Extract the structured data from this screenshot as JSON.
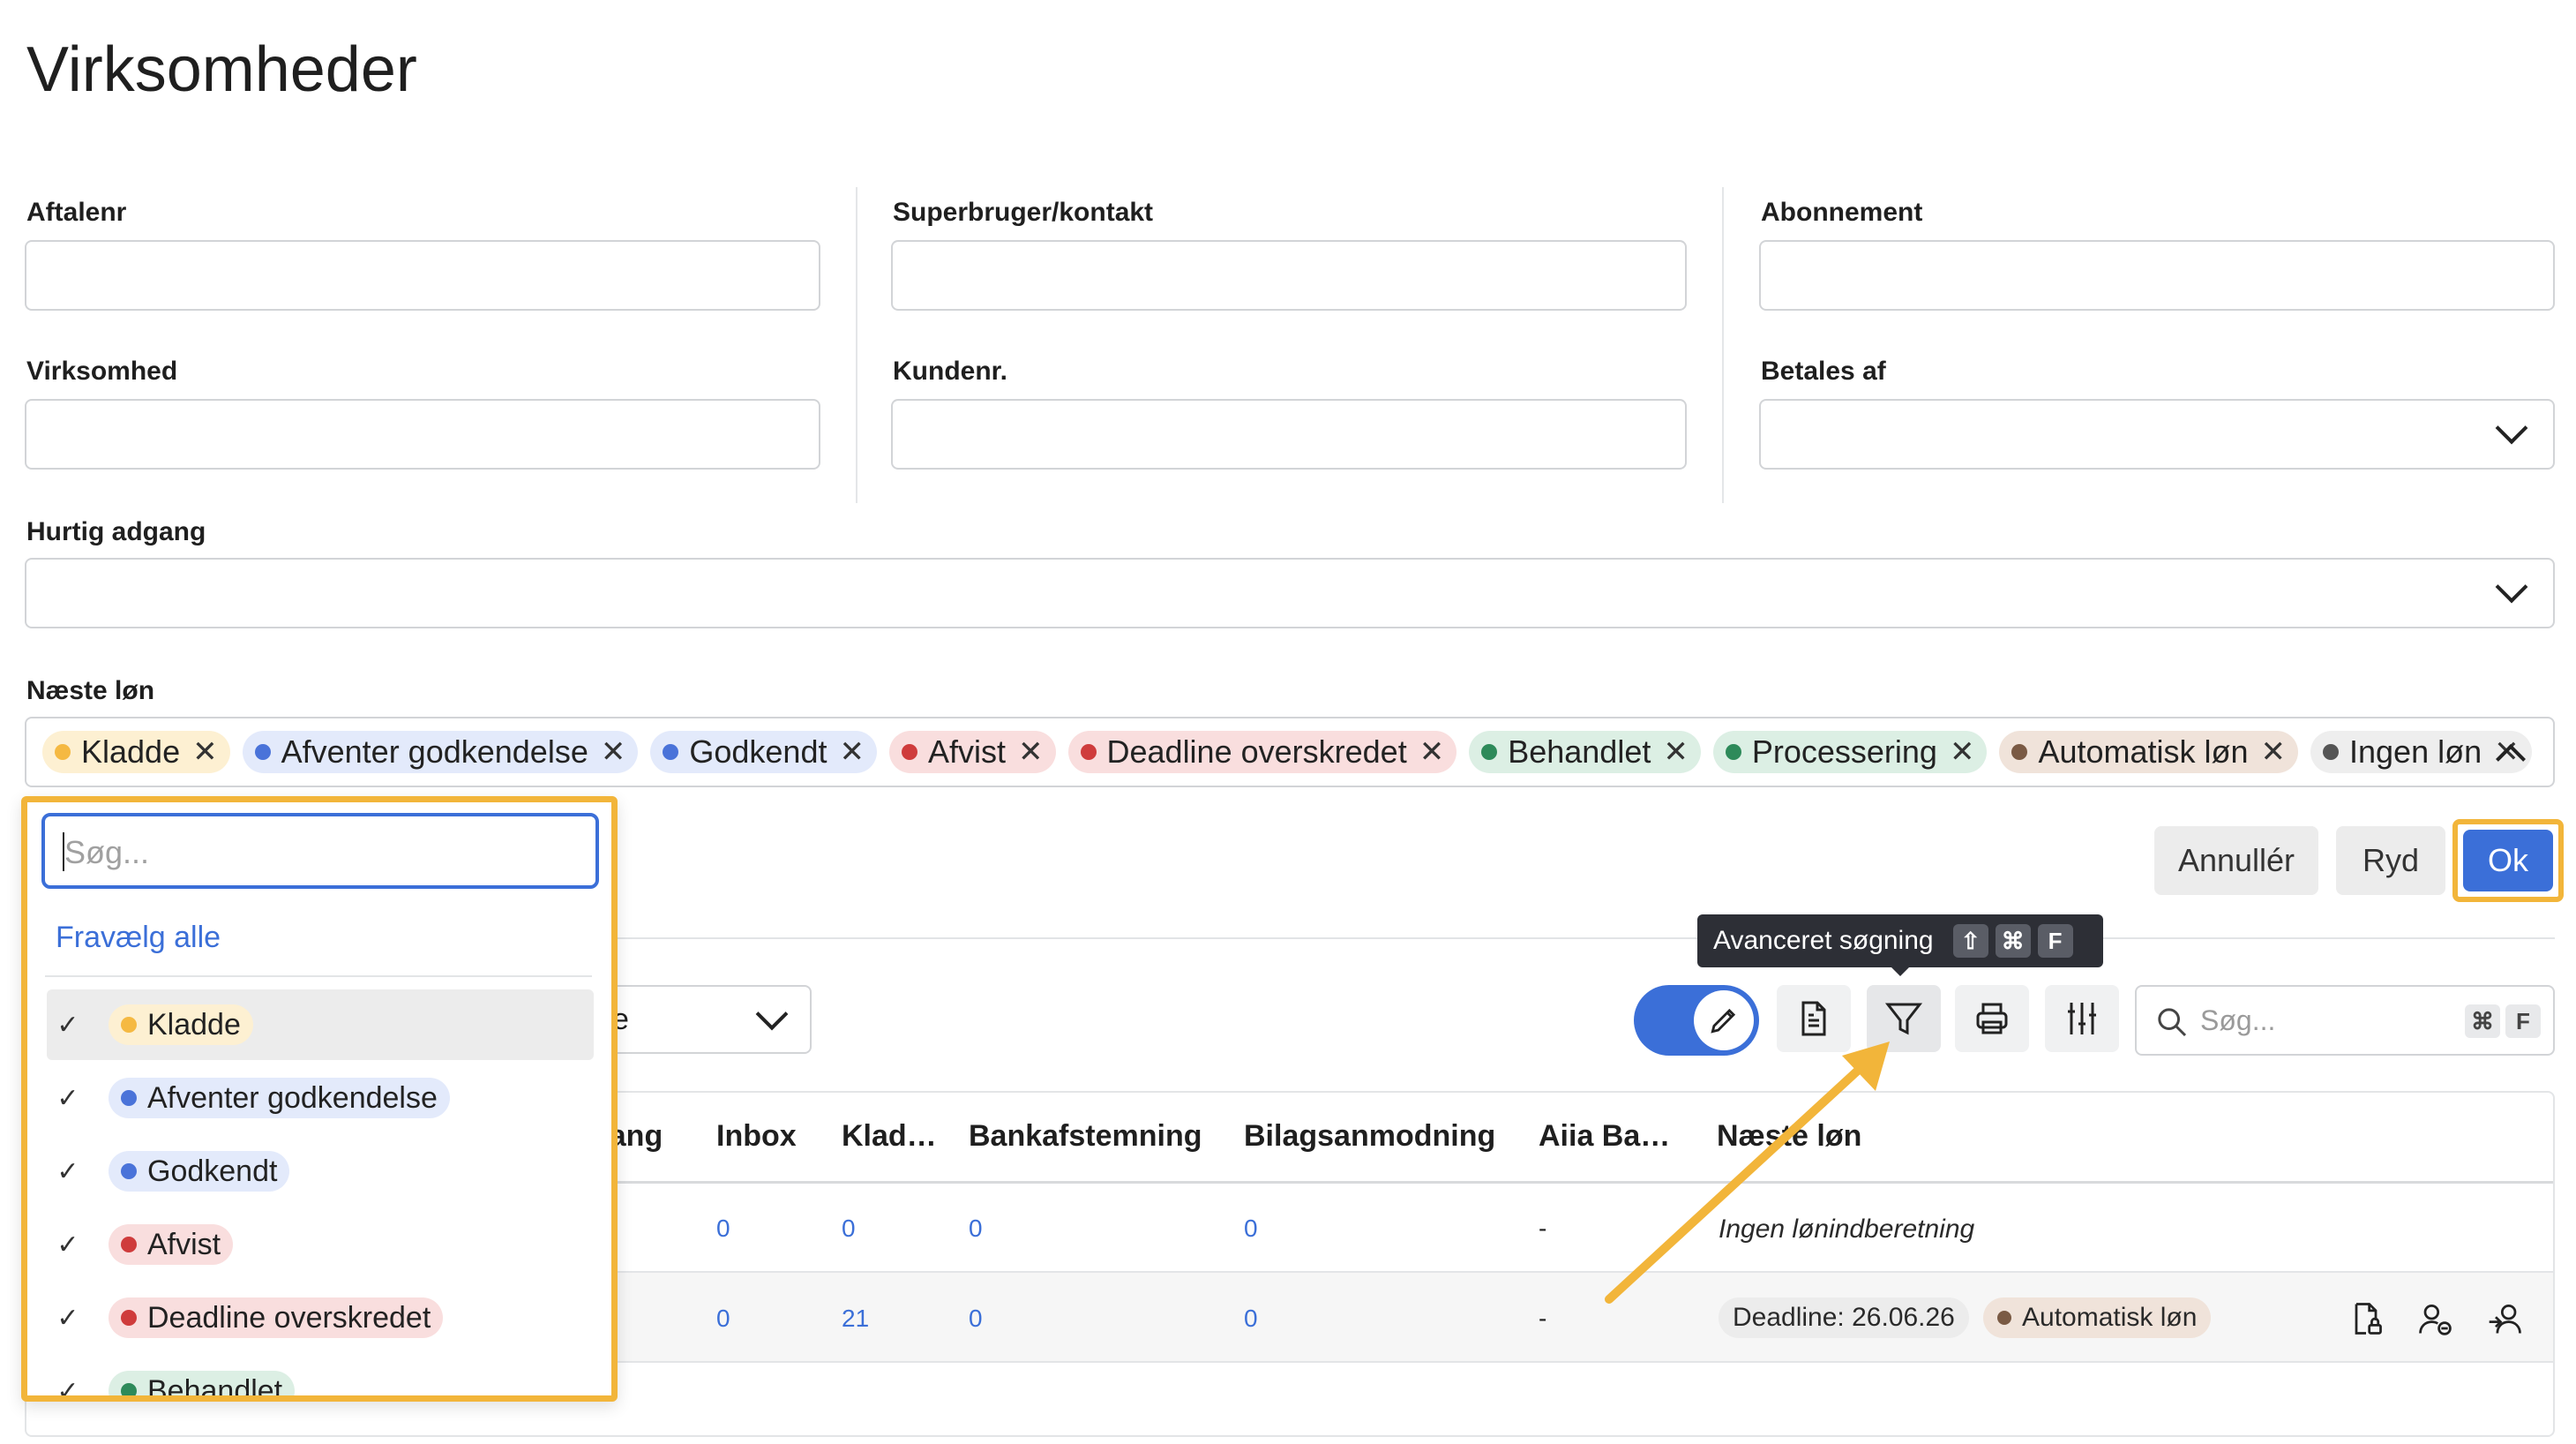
{
  "page": {
    "title": "Virksomheder"
  },
  "form": {
    "aftalenr": "Aftalenr",
    "superbruger": "Superbruger/kontakt",
    "abonnement": "Abonnement",
    "virksomhed": "Virksomhed",
    "kundenr": "Kundenr.",
    "betales_af": "Betales af",
    "hurtig_adgang": "Hurtig adgang",
    "naeste_lon": "Næste løn"
  },
  "selected_chips": [
    {
      "label": "Kladde",
      "dot": "#f5b942",
      "bg": "#fdf0d2"
    },
    {
      "label": "Afventer godkendelse",
      "dot": "#4a73d9",
      "bg": "#e3eafb"
    },
    {
      "label": "Godkendt",
      "dot": "#4a73d9",
      "bg": "#e3eafb"
    },
    {
      "label": "Afvist",
      "dot": "#cf3c3c",
      "bg": "#f9dede"
    },
    {
      "label": "Deadline overskredet",
      "dot": "#cf3c3c",
      "bg": "#f9dede"
    },
    {
      "label": "Behandlet",
      "dot": "#2e8a5a",
      "bg": "#dcefe4"
    },
    {
      "label": "Processering",
      "dot": "#2e8a5a",
      "bg": "#dcefe4"
    },
    {
      "label": "Automatisk løn",
      "dot": "#7a5a44",
      "bg": "#f0e3da"
    },
    {
      "label": "Ingen løn",
      "dot": "#555555",
      "bg": "#eeeeee"
    }
  ],
  "actions": {
    "cancel": "Annullér",
    "clear": "Ryd",
    "ok": "Ok"
  },
  "dropdown": {
    "search_placeholder": "Søg...",
    "deselect_all": "Fravælg alle",
    "check_glyph": "✓",
    "options": [
      {
        "label": "Kladde",
        "dot": "#f5b942",
        "bg": "#fdf0d2",
        "checked": true,
        "highlighted": true
      },
      {
        "label": "Afventer godkendelse",
        "dot": "#4a73d9",
        "bg": "#e3eafb",
        "checked": true
      },
      {
        "label": "Godkendt",
        "dot": "#4a73d9",
        "bg": "#e3eafb",
        "checked": true
      },
      {
        "label": "Afvist",
        "dot": "#cf3c3c",
        "bg": "#f9dede",
        "checked": true
      },
      {
        "label": "Deadline overskredet",
        "dot": "#cf3c3c",
        "bg": "#f9dede",
        "checked": true
      },
      {
        "label": "Behandlet",
        "dot": "#2e8a5a",
        "bg": "#dcefe4",
        "checked": true
      }
    ]
  },
  "view_select": {
    "value_fragment": "e"
  },
  "tooltip": {
    "text": "Avanceret søgning",
    "keys": [
      "⇧",
      "⌘",
      "F"
    ]
  },
  "toolbar_search": {
    "placeholder": "Søg...",
    "keys": [
      "⌘",
      "F"
    ]
  },
  "table": {
    "headers": [
      "gang",
      "Inbox",
      "Klad…",
      "Bankafstemning",
      "Bilagsanmodning",
      "Aiia Ba…",
      "Næste løn"
    ],
    "rows": [
      {
        "inbox": "0",
        "kladde": "0",
        "bank": "0",
        "bilag": "0",
        "aiia": "-",
        "naeste": "Ingen lønindberetning"
      },
      {
        "inbox": "0",
        "kladde": "21",
        "bank": "0",
        "bilag": "0",
        "aiia": "-",
        "deadline": "Deadline: 26.06.26",
        "status": "Automatisk løn",
        "status_dot": "#7a5a44",
        "status_bg": "#f0e3da"
      }
    ]
  },
  "colors": {
    "accent": "#3b6fd8",
    "highlight": "#f2b53a",
    "tooltip_bg": "#2d2f36"
  }
}
